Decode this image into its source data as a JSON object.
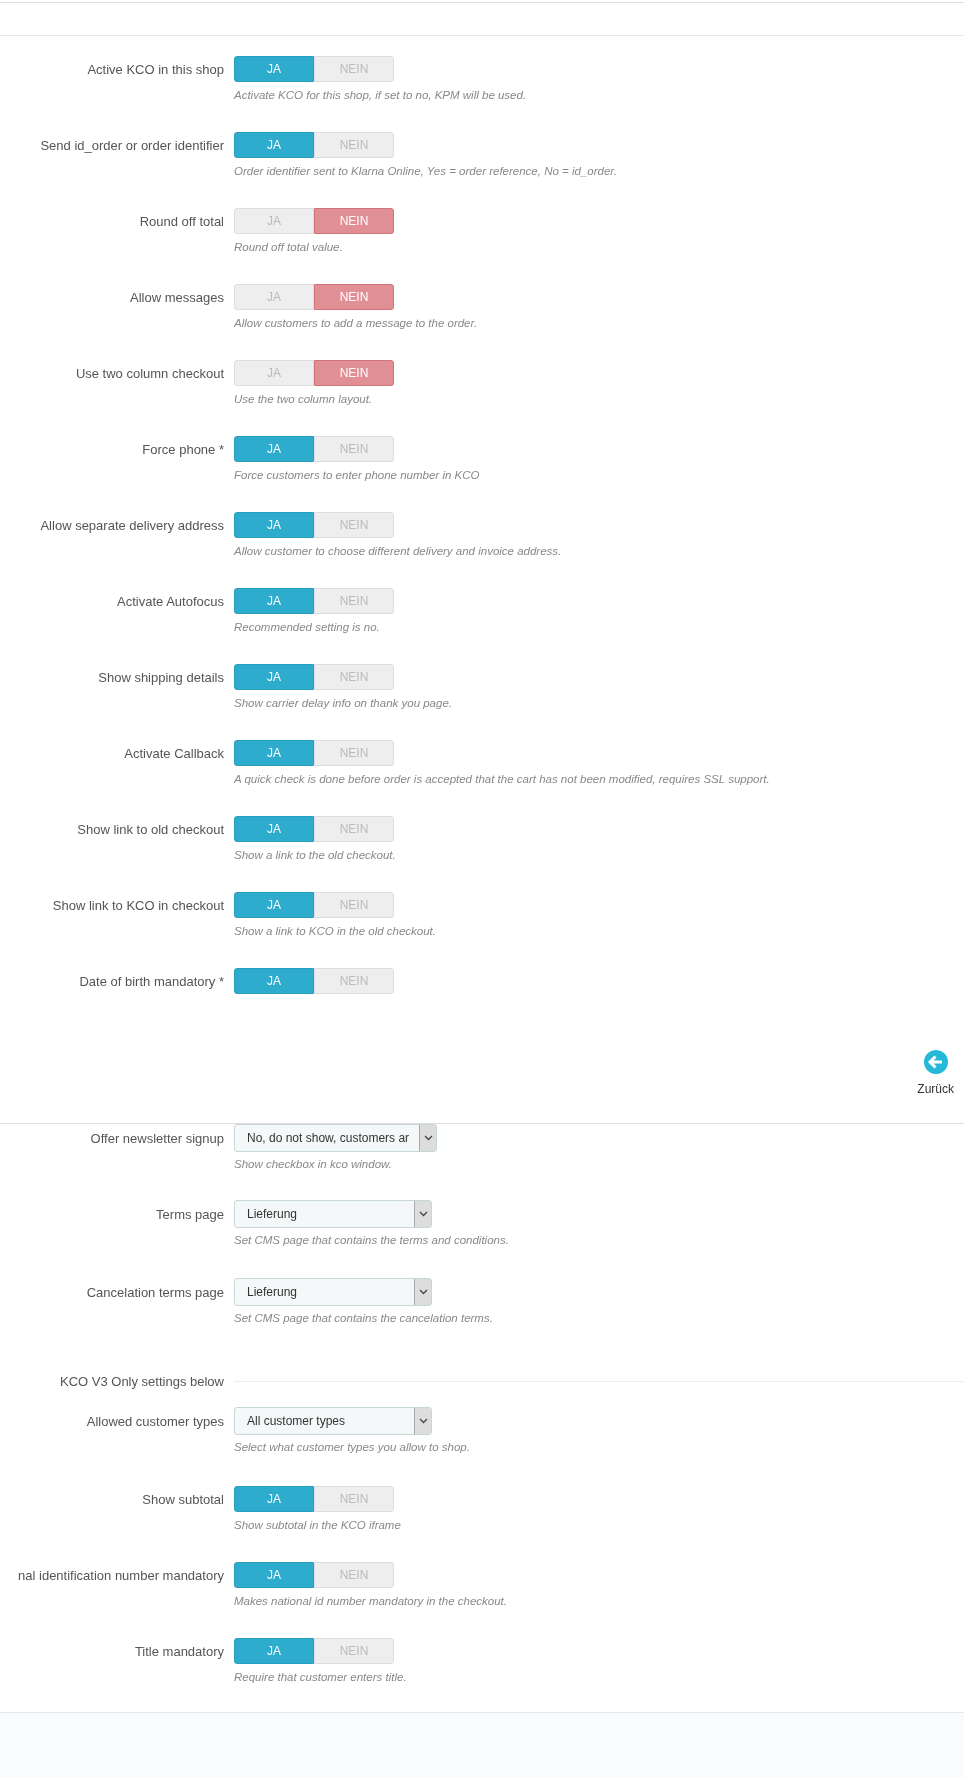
{
  "section_1": {
    "rows": [
      {
        "kind": "toggle",
        "label": "Active KCO in this shop",
        "options": [
          {
            "label": "JA",
            "selected": true
          },
          {
            "label": "NEIN",
            "selected": false
          }
        ],
        "help": "Activate KCO for this shop, if set to no, KPM will be used."
      },
      {
        "kind": "toggle",
        "label": "Send id_order or order identifier",
        "options": [
          {
            "label": "JA",
            "selected": true
          },
          {
            "label": "NEIN",
            "selected": false
          }
        ],
        "help": "Order identifier sent to Klarna Online, Yes = order reference, No = id_order."
      },
      {
        "kind": "toggle",
        "label": "Round off total",
        "options": [
          {
            "label": "JA",
            "selected": false
          },
          {
            "label": "NEIN",
            "selected": true
          }
        ],
        "help": "Round off total value."
      },
      {
        "kind": "toggle",
        "label": "Allow messages",
        "options": [
          {
            "label": "JA",
            "selected": false
          },
          {
            "label": "NEIN",
            "selected": true
          }
        ],
        "help": "Allow customers to add a message to the order."
      },
      {
        "kind": "toggle",
        "label": "Use two column checkout",
        "options": [
          {
            "label": "JA",
            "selected": false
          },
          {
            "label": "NEIN",
            "selected": true
          }
        ],
        "help": "Use the two column layout."
      },
      {
        "kind": "toggle",
        "label": "Force phone *",
        "options": [
          {
            "label": "JA",
            "selected": true
          },
          {
            "label": "NEIN",
            "selected": false
          }
        ],
        "help": "Force customers to enter phone number in KCO"
      },
      {
        "kind": "toggle",
        "label": "Allow separate delivery address",
        "options": [
          {
            "label": "JA",
            "selected": true
          },
          {
            "label": "NEIN",
            "selected": false
          }
        ],
        "help": "Allow customer to choose different delivery and invoice address."
      },
      {
        "kind": "toggle",
        "label": "Activate Autofocus",
        "options": [
          {
            "label": "JA",
            "selected": true
          },
          {
            "label": "NEIN",
            "selected": false
          }
        ],
        "help": "Recommended setting is no."
      },
      {
        "kind": "toggle",
        "label": "Show shipping details",
        "options": [
          {
            "label": "JA",
            "selected": true
          },
          {
            "label": "NEIN",
            "selected": false
          }
        ],
        "help": "Show carrier delay info on thank you page."
      },
      {
        "kind": "toggle",
        "label": "Activate Callback",
        "options": [
          {
            "label": "JA",
            "selected": true
          },
          {
            "label": "NEIN",
            "selected": false
          }
        ],
        "help": "A quick check is done before order is accepted that the cart has not been modified, requires SSL support."
      },
      {
        "kind": "toggle",
        "label": "Show link to old checkout",
        "options": [
          {
            "label": "JA",
            "selected": true
          },
          {
            "label": "NEIN",
            "selected": false
          }
        ],
        "help": "Show a link to the old checkout."
      },
      {
        "kind": "toggle",
        "label": "Show link to KCO in checkout",
        "options": [
          {
            "label": "JA",
            "selected": true
          },
          {
            "label": "NEIN",
            "selected": false
          }
        ],
        "help": "Show a link to KCO in the old checkout."
      },
      {
        "kind": "toggle",
        "label": "Date of birth mandatory *",
        "options": [
          {
            "label": "JA",
            "selected": true
          },
          {
            "label": "NEIN",
            "selected": false
          }
        ]
      }
    ]
  },
  "back_button": {
    "label": "Zurück"
  },
  "section_2": {
    "rows": [
      {
        "kind": "select",
        "label": "Offer newsletter signup",
        "value": "No, do not show, customers ar",
        "help": "Show checkbox in kco window."
      },
      {
        "kind": "select",
        "label": "Terms page",
        "value": "Lieferung",
        "help": "Set CMS page that contains the terms and conditions."
      },
      {
        "kind": "select",
        "label": "Cancelation terms page",
        "value": "Lieferung",
        "help": "Set CMS page that contains the cancelation terms."
      },
      {
        "kind": "heading",
        "label": "KCO V3 Only settings below"
      },
      {
        "kind": "select",
        "label": "Allowed customer types",
        "value": "All customer types",
        "help": "Select what customer types you allow to shop."
      },
      {
        "kind": "toggle",
        "label": "Show subtotal",
        "options": [
          {
            "label": "JA",
            "selected": true
          },
          {
            "label": "NEIN",
            "selected": false
          }
        ],
        "help": "Show subtotal in the KCO iframe"
      },
      {
        "kind": "toggle",
        "label": "nal identification number mandatory",
        "options": [
          {
            "label": "JA",
            "selected": true
          },
          {
            "label": "NEIN",
            "selected": false
          }
        ],
        "help": "Makes national id number mandatory in the checkout."
      },
      {
        "kind": "toggle",
        "label": "Title mandatory",
        "options": [
          {
            "label": "JA",
            "selected": true
          },
          {
            "label": "NEIN",
            "selected": false
          }
        ],
        "help": "Require that customer enters title."
      }
    ]
  }
}
